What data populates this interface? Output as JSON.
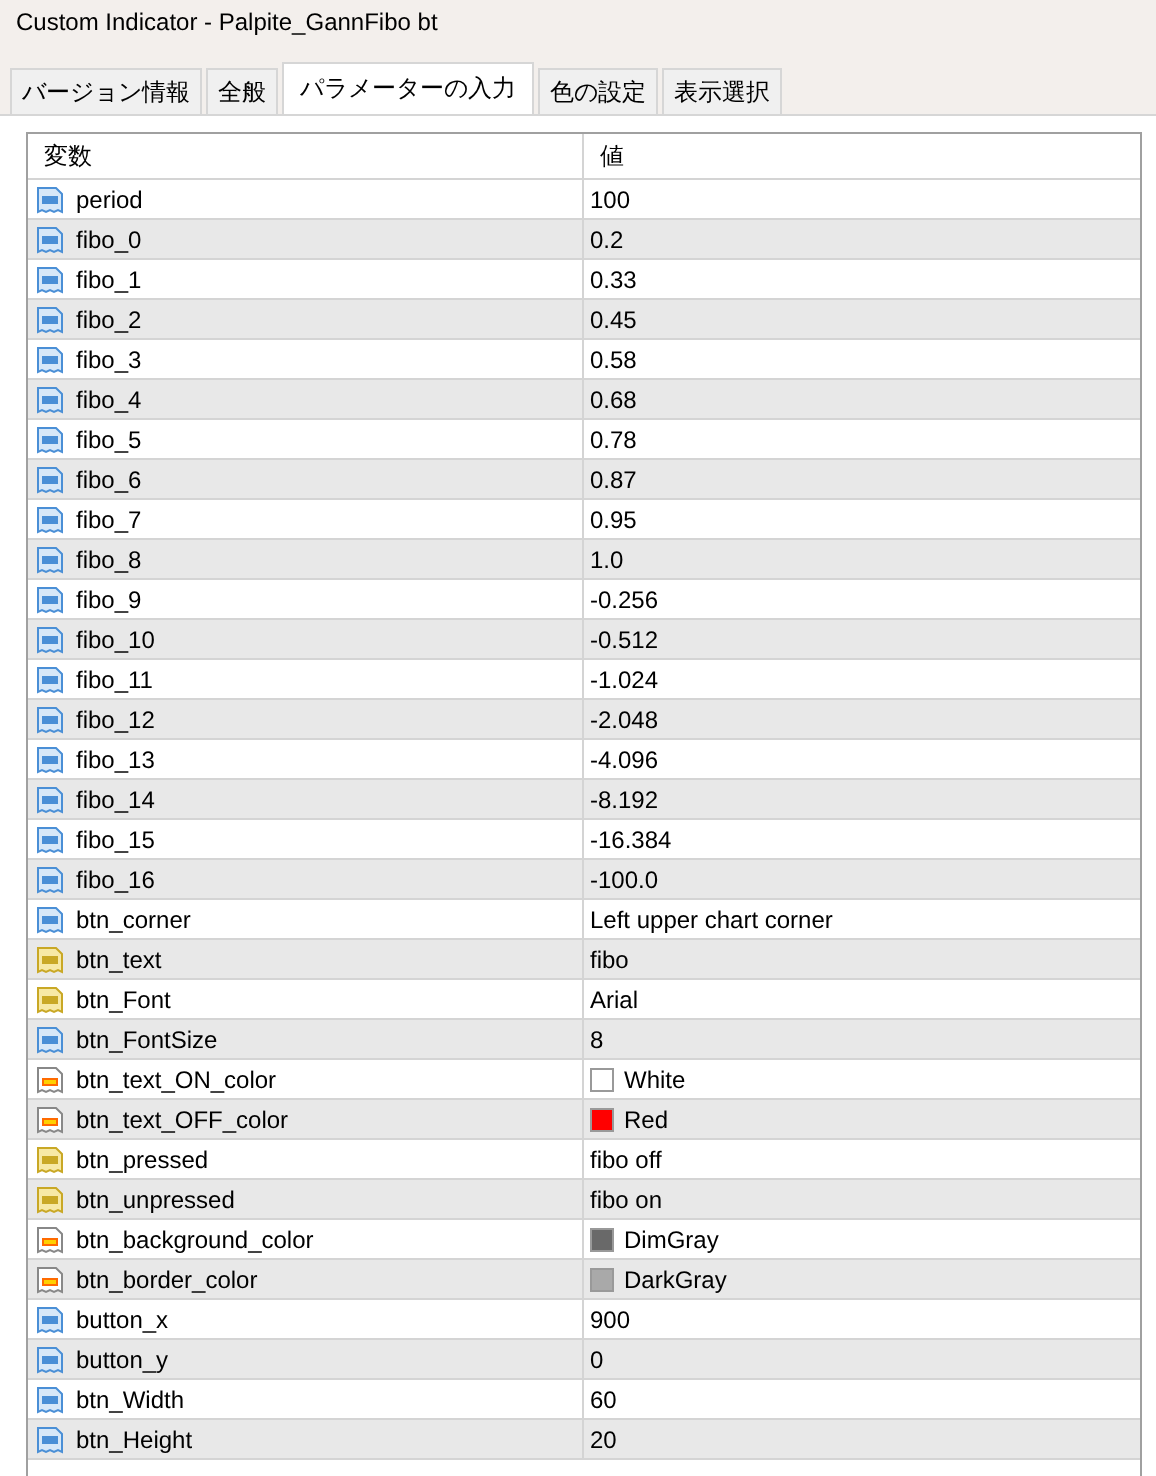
{
  "window": {
    "title": "Custom Indicator - Palpite_GannFibo bt"
  },
  "tabs": [
    {
      "label": "バージョン情報",
      "selected": false
    },
    {
      "label": "全般",
      "selected": false
    },
    {
      "label": "パラメーターの入力",
      "selected": true
    },
    {
      "label": "色の設定",
      "selected": false
    },
    {
      "label": "表示選択",
      "selected": false
    }
  ],
  "table": {
    "columns": [
      "変数",
      "値"
    ],
    "rows": [
      {
        "kind": "int",
        "name": "period",
        "value": "100"
      },
      {
        "kind": "double",
        "name": "fibo_0",
        "value": "0.2"
      },
      {
        "kind": "double",
        "name": "fibo_1",
        "value": "0.33"
      },
      {
        "kind": "double",
        "name": "fibo_2",
        "value": "0.45"
      },
      {
        "kind": "double",
        "name": "fibo_3",
        "value": "0.58"
      },
      {
        "kind": "double",
        "name": "fibo_4",
        "value": "0.68"
      },
      {
        "kind": "double",
        "name": "fibo_5",
        "value": "0.78"
      },
      {
        "kind": "double",
        "name": "fibo_6",
        "value": "0.87"
      },
      {
        "kind": "double",
        "name": "fibo_7",
        "value": "0.95"
      },
      {
        "kind": "double",
        "name": "fibo_8",
        "value": "1.0"
      },
      {
        "kind": "double",
        "name": "fibo_9",
        "value": "-0.256"
      },
      {
        "kind": "double",
        "name": "fibo_10",
        "value": "-0.512"
      },
      {
        "kind": "double",
        "name": "fibo_11",
        "value": "-1.024"
      },
      {
        "kind": "double",
        "name": "fibo_12",
        "value": "-2.048"
      },
      {
        "kind": "double",
        "name": "fibo_13",
        "value": "-4.096"
      },
      {
        "kind": "double",
        "name": "fibo_14",
        "value": "-8.192"
      },
      {
        "kind": "double",
        "name": "fibo_15",
        "value": "-16.384"
      },
      {
        "kind": "double",
        "name": "fibo_16",
        "value": "-100.0"
      },
      {
        "kind": "int",
        "name": "btn_corner",
        "value": "Left upper chart corner"
      },
      {
        "kind": "string",
        "name": "btn_text",
        "value": "fibo"
      },
      {
        "kind": "string",
        "name": "btn_Font",
        "value": "Arial"
      },
      {
        "kind": "int",
        "name": "btn_FontSize",
        "value": "8"
      },
      {
        "kind": "color",
        "name": "btn_text_ON_color",
        "value": "White",
        "color": "#ffffff"
      },
      {
        "kind": "color",
        "name": "btn_text_OFF_color",
        "value": "Red",
        "color": "#ff0000"
      },
      {
        "kind": "string",
        "name": "btn_pressed",
        "value": "fibo off"
      },
      {
        "kind": "string",
        "name": "btn_unpressed",
        "value": "fibo on"
      },
      {
        "kind": "color",
        "name": "btn_background_color",
        "value": "DimGray",
        "color": "#696969"
      },
      {
        "kind": "color",
        "name": "btn_border_color",
        "value": "DarkGray",
        "color": "#a9a9a9"
      },
      {
        "kind": "int",
        "name": "button_x",
        "value": "900"
      },
      {
        "kind": "int",
        "name": "button_y",
        "value": "0"
      },
      {
        "kind": "int",
        "name": "btn_Width",
        "value": "60"
      },
      {
        "kind": "int",
        "name": "btn_Height",
        "value": "20"
      }
    ]
  }
}
